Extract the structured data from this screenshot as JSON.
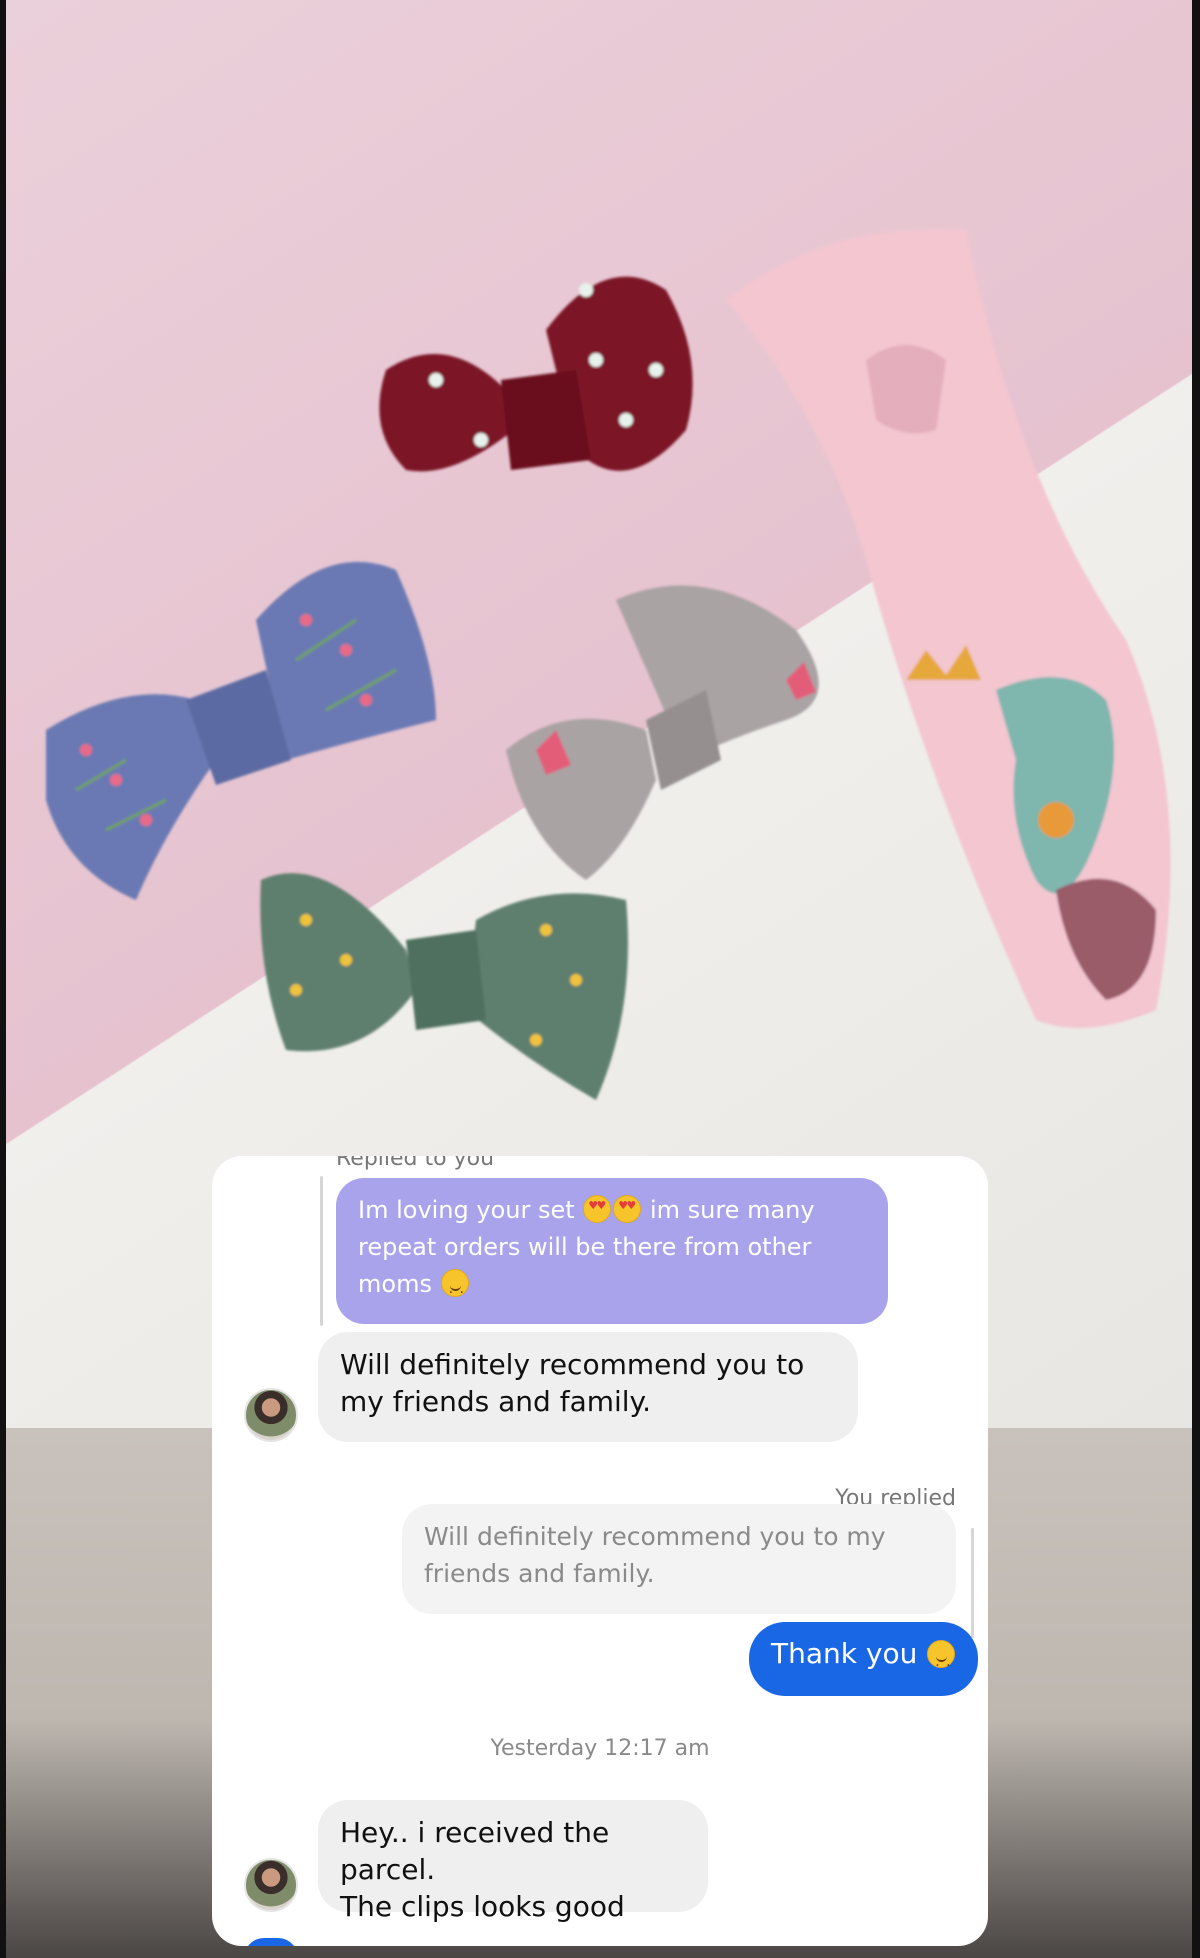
{
  "chat": {
    "replied_to_you": "Replied to you",
    "quoted_message": {
      "text": "Im loving your set",
      "text_2": "im sure many repeat orders will be there from other moms"
    },
    "incoming_1": "Will definitely recommend you to my friends and family.",
    "you_replied": "You replied",
    "quoted_reply": "Will definitely recommend you to my friends and family.",
    "outgoing_1": "Thank you",
    "timestamp": "Yesterday 12:17 am",
    "incoming_2_line1": "Hey.. i received the parcel.",
    "incoming_2_line2": "The clips looks good"
  },
  "colors": {
    "purple_bubble": "#a8a3eb",
    "blue_bubble": "#1a67e6",
    "grey_bubble": "#efefef"
  },
  "icons": [
    "heart-eyes-emoji",
    "smiling-emoji",
    "blush-emoji",
    "avatar"
  ]
}
